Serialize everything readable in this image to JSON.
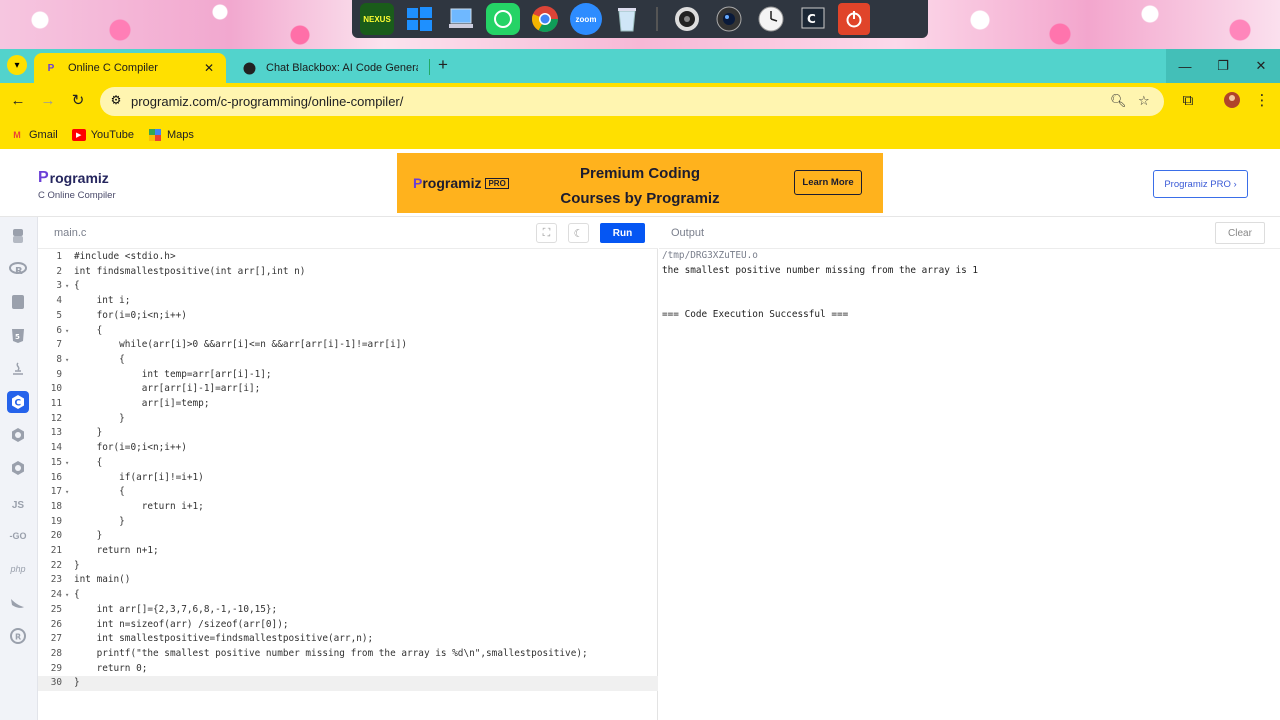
{
  "taskbar": {
    "icons": [
      "nexus-icon",
      "windows-icon",
      "computer-icon",
      "whatsapp-icon",
      "chrome-icon",
      "zoom-icon",
      "recycle-bin-icon",
      "speaker-icon",
      "camera-icon",
      "clock-icon",
      "terminal-icon",
      "power-icon"
    ],
    "nexus_label": "NEXUS",
    "zoom_label": "zoom"
  },
  "browser": {
    "tabs": [
      {
        "title": "Online C Compiler",
        "active": true
      },
      {
        "title": "Chat Blackbox: AI Code Generat",
        "active": false
      }
    ],
    "url": "programiz.com/c-programming/online-compiler/",
    "bookmarks": [
      {
        "label": "Gmail",
        "icon": "gmail-icon"
      },
      {
        "label": "YouTube",
        "icon": "youtube-icon"
      },
      {
        "label": "Maps",
        "icon": "maps-icon"
      }
    ],
    "colors": {
      "accent": "#ffe000",
      "tabbar": "#52d3cc"
    }
  },
  "site": {
    "logo": "rogramiz",
    "logo_p": "P",
    "subtitle": "C Online Compiler",
    "promo_logo": "rogramiz",
    "promo_pro": "PRO",
    "promo_line1": "Premium Coding",
    "promo_line2": "Courses by Programiz",
    "promo_button": "Learn More",
    "pro_button": "Programiz PRO ›"
  },
  "sidebar": {
    "languages": [
      "python",
      "r",
      "sql",
      "html",
      "java",
      "c",
      "cpp",
      "csharp",
      "js",
      "go",
      "php",
      "swift",
      "rust"
    ],
    "active": "c",
    "js_label": "JS",
    "go_label": "-GO",
    "php_label": "php"
  },
  "editor": {
    "filename": "main.c",
    "run_label": "Run",
    "lines": [
      "#include <stdio.h>",
      "int findsmallestpositive(int arr[],int n)",
      "{",
      "    int i;",
      "    for(i=0;i<n;i++)",
      "    {",
      "        while(arr[i]>0 &&arr[i]<=n &&arr[arr[i]-1]!=arr[i])",
      "        {",
      "            int temp=arr[arr[i]-1];",
      "            arr[arr[i]-1]=arr[i];",
      "            arr[i]=temp;",
      "        }",
      "    }",
      "    for(i=0;i<n;i++)",
      "    {",
      "        if(arr[i]!=i+1)",
      "        {",
      "            return i+1;",
      "        }",
      "    }",
      "    return n+1;",
      "}",
      "int main()",
      "{",
      "    int arr[]={2,3,7,6,8,-1,-10,15};",
      "    int n=sizeof(arr) /sizeof(arr[0]);",
      "    int smallestpositive=findsmallestpositive(arr,n);",
      "    printf(\"the smallest positive number missing from the array is %d\\n\",smallestpositive);",
      "    return 0;",
      "}"
    ],
    "fold_lines": [
      3,
      6,
      8,
      15,
      17,
      24
    ],
    "current_line": 30
  },
  "output": {
    "title": "Output",
    "clear_label": "Clear",
    "lines": [
      "/tmp/DRG3XZuTEU.o",
      "the smallest positive number missing from the array is 1",
      "",
      "",
      "=== Code Execution Successful ==="
    ]
  }
}
